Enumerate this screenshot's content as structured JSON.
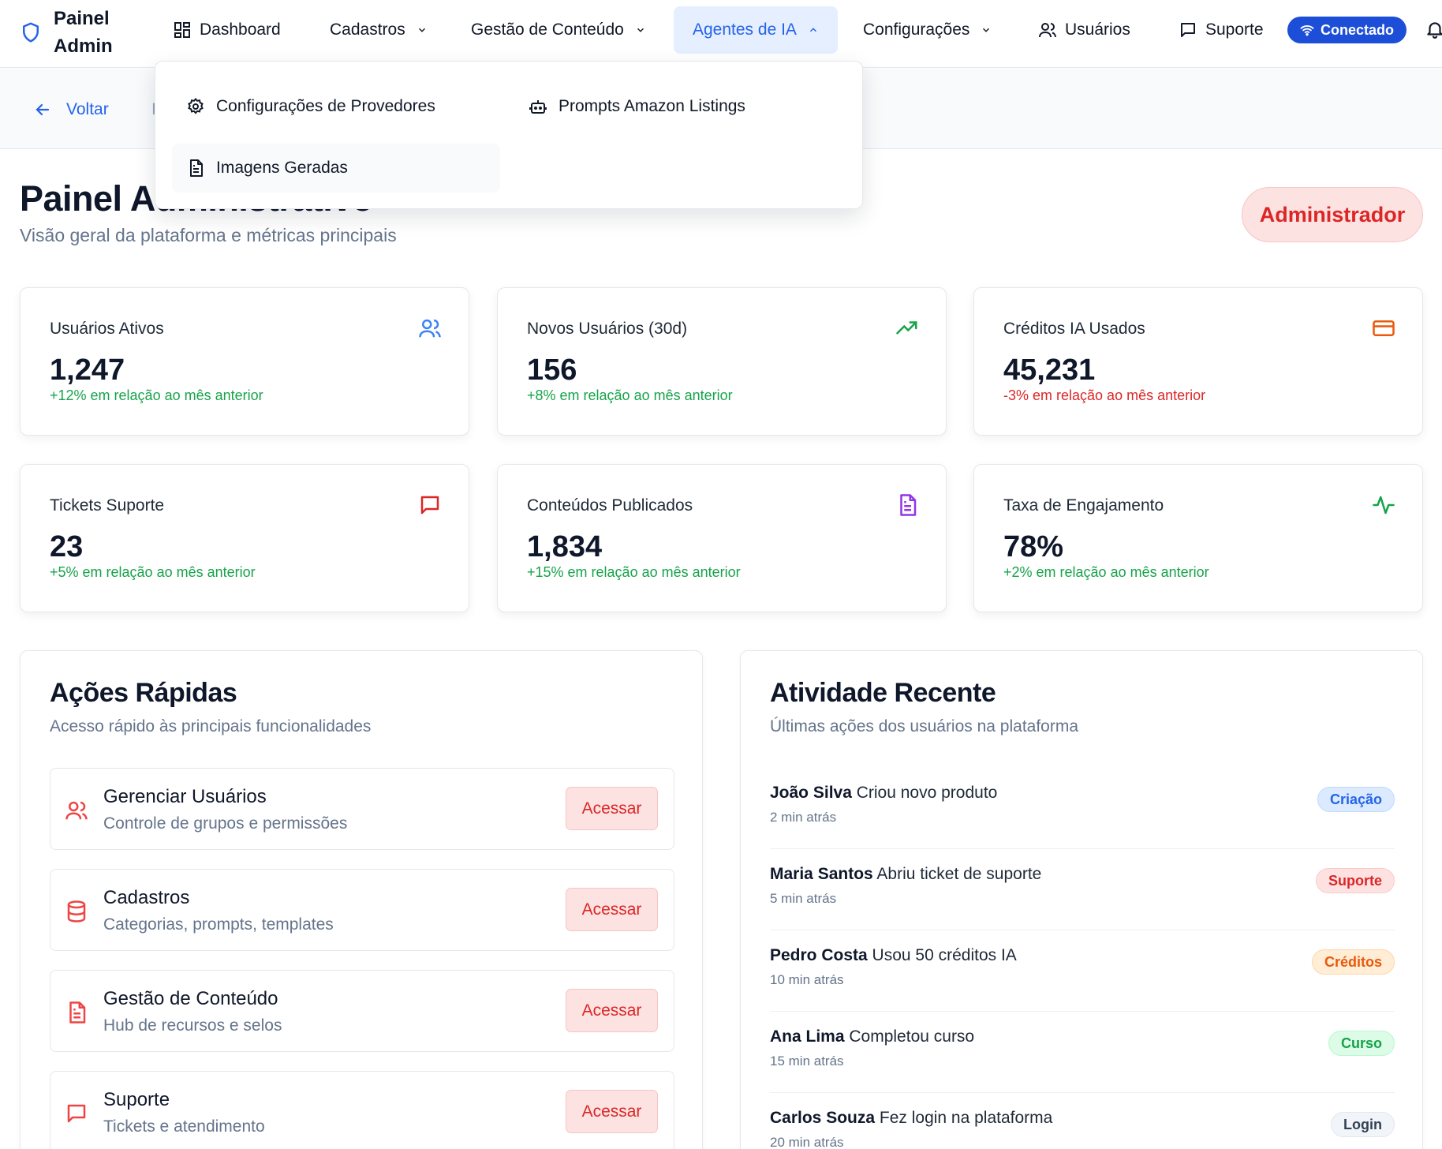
{
  "brand": {
    "title": "Painel Admin"
  },
  "nav": {
    "dashboard": "Dashboard",
    "cadastros": "Cadastros",
    "gestao": "Gestão de Conteúdo",
    "agentes": "Agentes de IA",
    "configuracoes": "Configurações",
    "usuarios": "Usuários",
    "suporte": "Suporte",
    "status": "Conectado"
  },
  "dropdown": {
    "items": [
      {
        "label": "Configurações de Provedores",
        "icon": "gear-icon"
      },
      {
        "label": "Prompts Amazon Listings",
        "icon": "bot-icon"
      },
      {
        "label": "Imagens Geradas",
        "icon": "document-icon"
      }
    ]
  },
  "subbar": {
    "back": "Voltar",
    "crumb": "I"
  },
  "page": {
    "title": "Painel Administrativo",
    "subtitle": "Visão geral da plataforma e métricas principais",
    "role": "Administrador"
  },
  "stats": [
    {
      "label": "Usuários Ativos",
      "value": "1,247",
      "change": "+12% em relação ao mês anterior",
      "trend": "positive",
      "icon": "users-icon",
      "color": "#3b82f6"
    },
    {
      "label": "Novos Usuários (30d)",
      "value": "156",
      "change": "+8% em relação ao mês anterior",
      "trend": "positive",
      "icon": "trending-up-icon",
      "color": "#16a34a"
    },
    {
      "label": "Créditos IA Usados",
      "value": "45,231",
      "change": "-3% em relação ao mês anterior",
      "trend": "negative",
      "icon": "credit-card-icon",
      "color": "#ea580c"
    },
    {
      "label": "Tickets Suporte",
      "value": "23",
      "change": "+5% em relação ao mês anterior",
      "trend": "positive",
      "icon": "message-icon",
      "color": "#dc2626"
    },
    {
      "label": "Conteúdos Publicados",
      "value": "1,834",
      "change": "+15% em relação ao mês anterior",
      "trend": "positive",
      "icon": "file-icon",
      "color": "#9333ea"
    },
    {
      "label": "Taxa de Engajamento",
      "value": "78%",
      "change": "+2% em relação ao mês anterior",
      "trend": "positive",
      "icon": "activity-icon",
      "color": "#16a34a"
    }
  ],
  "quick_actions": {
    "title": "Ações Rápidas",
    "subtitle": "Acesso rápido às principais funcionalidades",
    "items": [
      {
        "title": "Gerenciar Usuários",
        "desc": "Controle de grupos e permissões",
        "button": "Acessar",
        "icon": "users-icon"
      },
      {
        "title": "Cadastros",
        "desc": "Categorias, prompts, templates",
        "button": "Acessar",
        "icon": "database-icon"
      },
      {
        "title": "Gestão de Conteúdo",
        "desc": "Hub de recursos e selos",
        "button": "Acessar",
        "icon": "file-icon"
      },
      {
        "title": "Suporte",
        "desc": "Tickets e atendimento",
        "button": "Acessar",
        "icon": "message-icon"
      }
    ]
  },
  "activity": {
    "title": "Atividade Recente",
    "subtitle": "Últimas ações dos usuários na plataforma",
    "items": [
      {
        "user": "João Silva",
        "action": "Criou novo produto",
        "time": "2 min atrás",
        "tag": "Criação",
        "tag_color": "#2563eb",
        "tag_bg": "#dbeafe"
      },
      {
        "user": "Maria Santos",
        "action": "Abriu ticket de suporte",
        "time": "5 min atrás",
        "tag": "Suporte",
        "tag_color": "#dc2626",
        "tag_bg": "#fee2e2"
      },
      {
        "user": "Pedro Costa",
        "action": "Usou 50 créditos IA",
        "time": "10 min atrás",
        "tag": "Créditos",
        "tag_color": "#ea580c",
        "tag_bg": "#ffedd5"
      },
      {
        "user": "Ana Lima",
        "action": "Completou curso",
        "time": "15 min atrás",
        "tag": "Curso",
        "tag_color": "#16a34a",
        "tag_bg": "#dcfce7"
      },
      {
        "user": "Carlos Souza",
        "action": "Fez login na plataforma",
        "time": "20 min atrás",
        "tag": "Login",
        "tag_color": "#334155",
        "tag_bg": "#f1f5f9"
      }
    ]
  }
}
